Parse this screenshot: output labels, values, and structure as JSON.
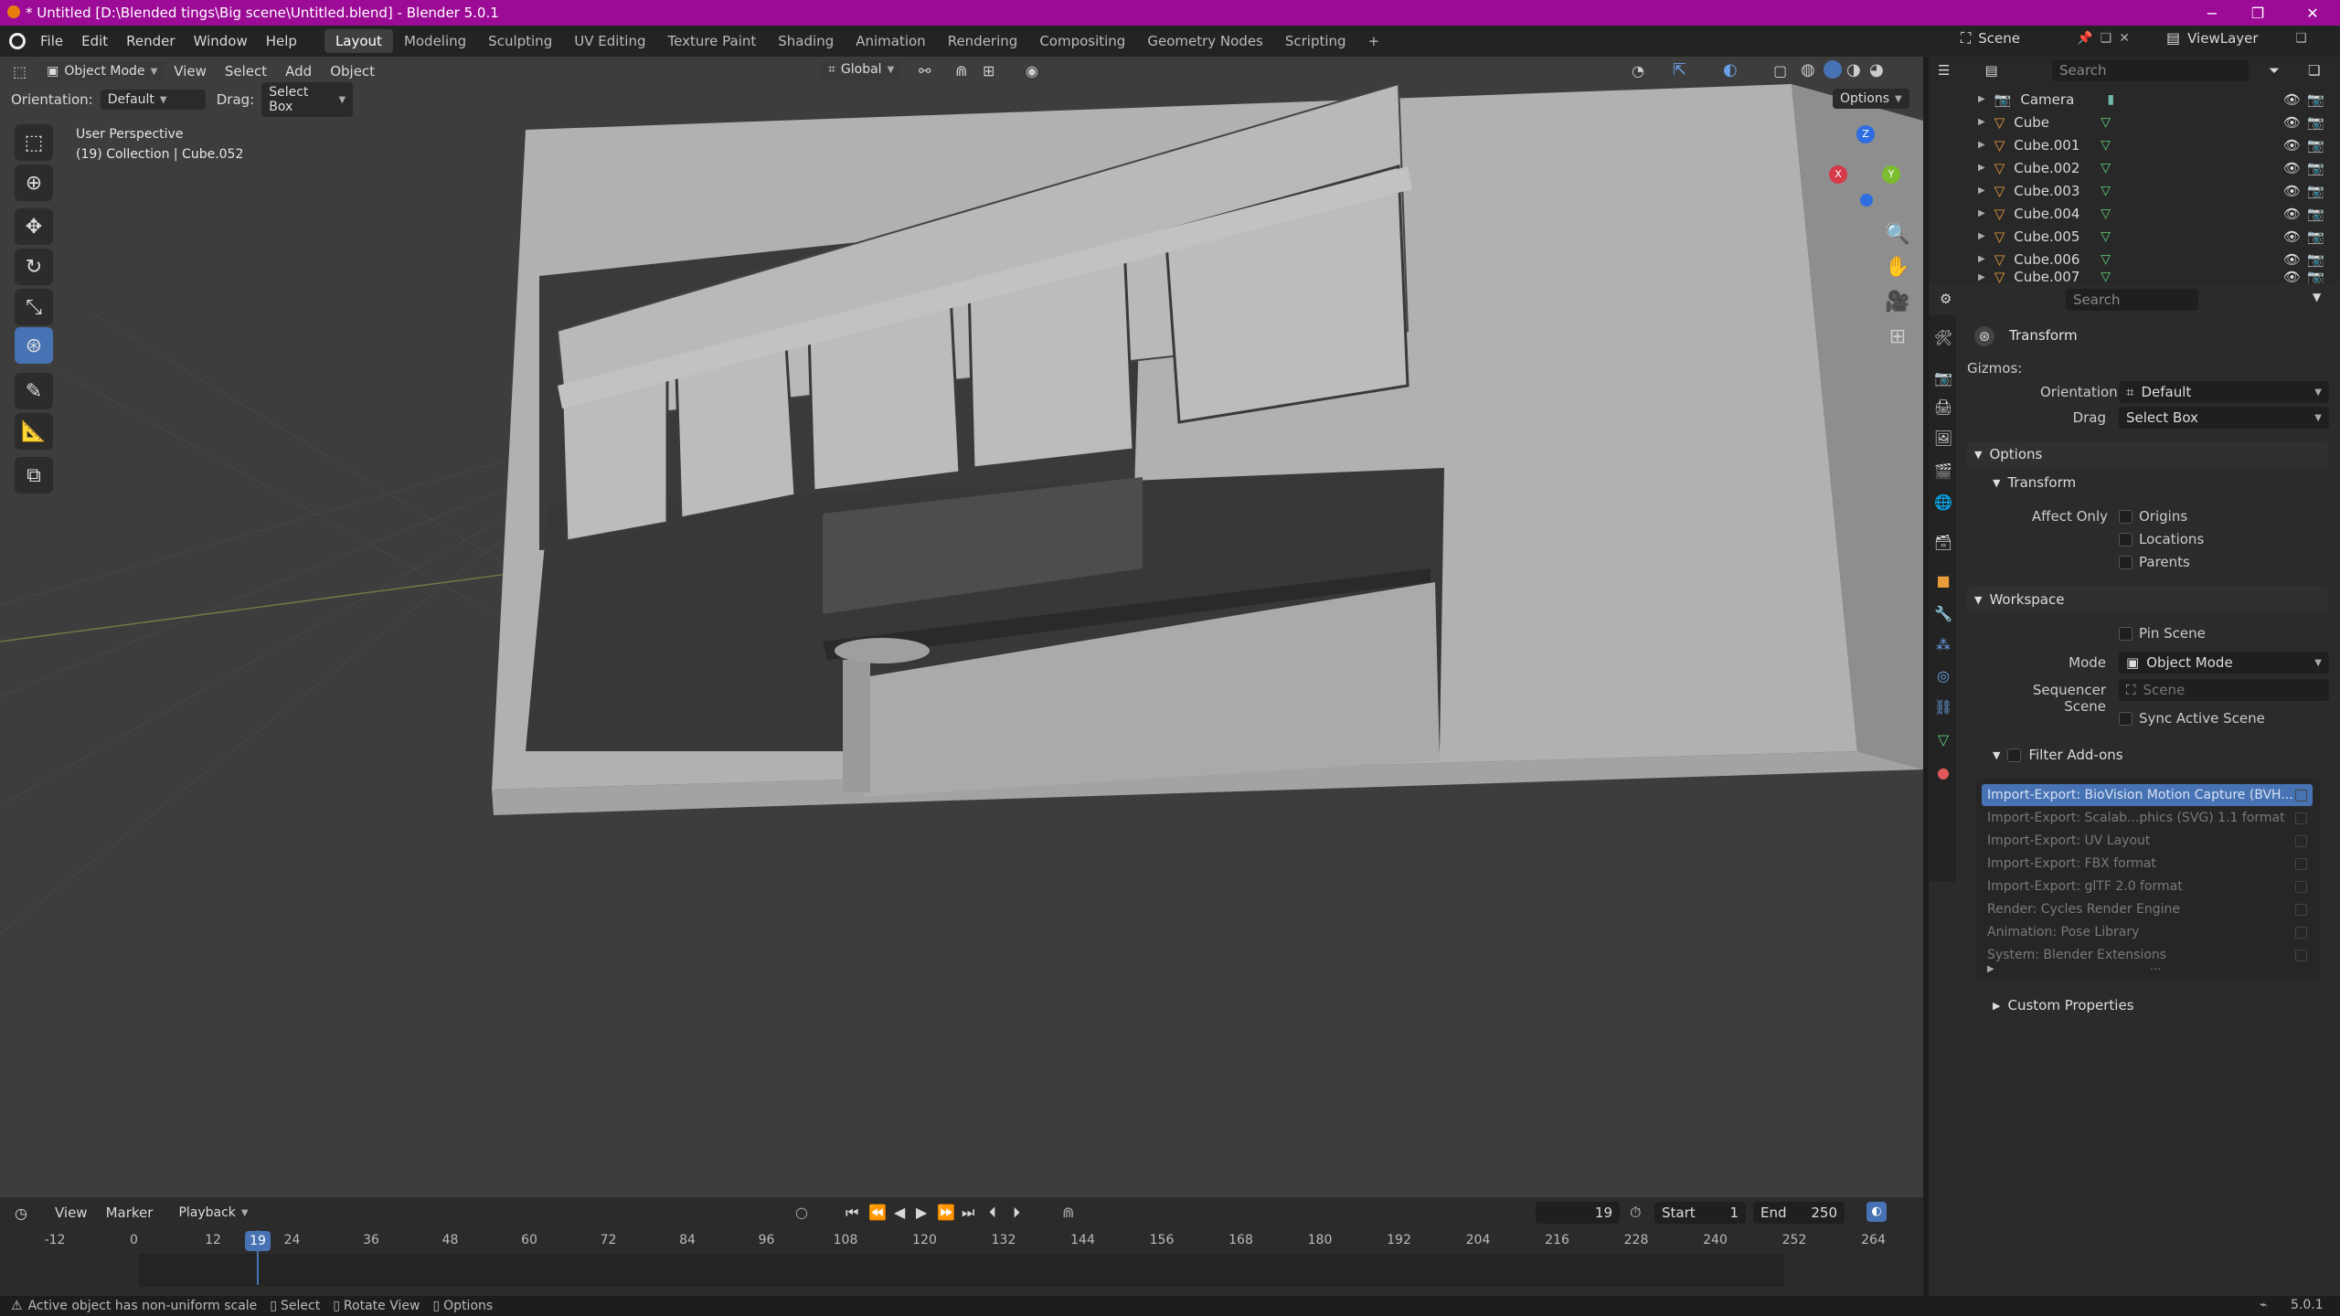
{
  "titlebar": {
    "title": "* Untitled [D:\\Blended tings\\Big scene\\Untitled.blend] - Blender 5.0.1",
    "minimize": "−",
    "restore": "❐",
    "close": "✕"
  },
  "menu": [
    "File",
    "Edit",
    "Render",
    "Window",
    "Help"
  ],
  "workspaces": [
    "Layout",
    "Modeling",
    "Sculpting",
    "UV Editing",
    "Texture Paint",
    "Shading",
    "Animation",
    "Rendering",
    "Compositing",
    "Geometry Nodes",
    "Scripting"
  ],
  "add_workspace": "+",
  "scene": {
    "name": "Scene",
    "view_layer": "ViewLayer"
  },
  "viewport": {
    "mode": "Object Mode",
    "menus": [
      "View",
      "Select",
      "Add",
      "Object"
    ],
    "transform_orientation": "Global",
    "orientation_label": "Orientation:",
    "orientation_value": "Default",
    "drag_label": "Drag:",
    "drag_value": "Select Box",
    "options": "Options",
    "overlay_title": "User Perspective",
    "overlay_sub": "(19) Collection | Cube.052",
    "gizmo_axes": {
      "z": "Z",
      "x": "X",
      "y": "Y"
    }
  },
  "outliner": {
    "search_placeholder": "Search",
    "items": [
      {
        "name": "Camera"
      },
      {
        "name": "Cube"
      },
      {
        "name": "Cube.001"
      },
      {
        "name": "Cube.002"
      },
      {
        "name": "Cube.003"
      },
      {
        "name": "Cube.004"
      },
      {
        "name": "Cube.005"
      },
      {
        "name": "Cube.006"
      },
      {
        "name": "Cube.007"
      }
    ]
  },
  "properties": {
    "search_placeholder": "Search",
    "header": "Transform",
    "gizmos_label": "Gizmos:",
    "orientation_label": "Orientation",
    "orientation_value": "Default",
    "drag_label": "Drag",
    "drag_value": "Select Box",
    "options_section": "Options",
    "transform_sub": "Transform",
    "affect_only_label": "Affect Only",
    "affect_only": [
      "Origins",
      "Locations",
      "Parents"
    ],
    "workspace_section": "Workspace",
    "pin_scene": "Pin Scene",
    "mode_label": "Mode",
    "mode_value": "Object Mode",
    "sequencer_label": "Sequencer Scene",
    "sequencer_placeholder": "Scene",
    "sync_active_scene": "Sync Active Scene",
    "filter_addons": "Filter Add-ons",
    "addons": [
      "Import-Export: BioVision Motion Capture (BVH...",
      "Import-Export: Scalab...phics (SVG) 1.1 format",
      "Import-Export: UV Layout",
      "Import-Export: FBX format",
      "Import-Export: glTF 2.0 format",
      "Render: Cycles Render Engine",
      "Animation: Pose Library",
      "System: Blender Extensions"
    ],
    "custom_properties": "Custom Properties"
  },
  "timeline": {
    "menus": [
      "View",
      "Marker",
      "Playback"
    ],
    "current_frame": "19",
    "start_label": "Start",
    "start_value": "1",
    "end_label": "End",
    "end_value": "250",
    "ticks": [
      "-12",
      "0",
      "12",
      "24",
      "36",
      "48",
      "60",
      "72",
      "84",
      "96",
      "108",
      "120",
      "132",
      "144",
      "156",
      "168",
      "180",
      "192",
      "204",
      "216",
      "228",
      "240",
      "252",
      "264"
    ],
    "playhead": "19"
  },
  "status": {
    "message": "Active object has non-uniform scale",
    "hints": [
      "Select",
      "Rotate View",
      "Options"
    ],
    "version": "5.0.1"
  },
  "colors": {
    "accent": "#4772b3",
    "titlebar": "#9c0b96",
    "object_orange": "#e89c3b",
    "mesh_green": "#5fd07a"
  }
}
